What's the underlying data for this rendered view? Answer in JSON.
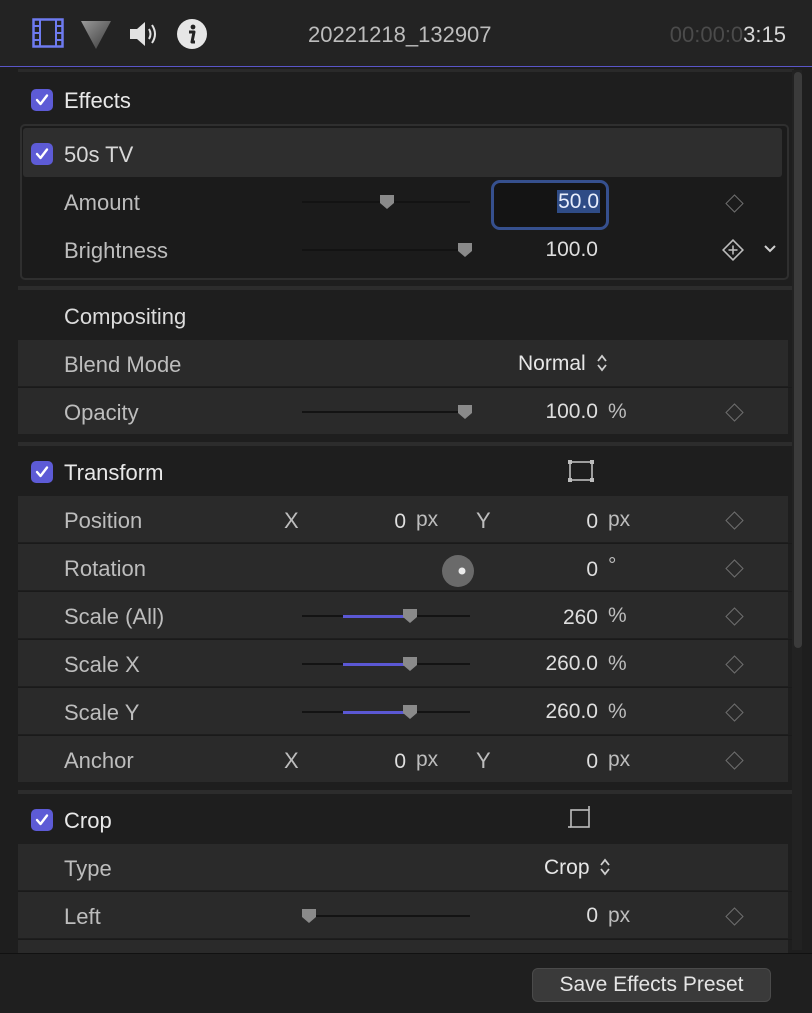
{
  "header": {
    "clip_name": "20221218_132907",
    "timecode_dim": "00:00:0",
    "timecode_bright": "3:15",
    "tabs": [
      "video-tab-icon",
      "color-tab-icon",
      "audio-tab-icon",
      "info-tab-icon"
    ]
  },
  "effects": {
    "title": "Effects",
    "checked": true,
    "tv": {
      "title": "50s TV",
      "checked": true,
      "amount": {
        "label": "Amount",
        "value": "50.0",
        "level": 0.5
      },
      "brightness": {
        "label": "Brightness",
        "value": "100.0",
        "level": 1.0
      }
    }
  },
  "compositing": {
    "title": "Compositing",
    "blend_mode": {
      "label": "Blend Mode",
      "value": "Normal"
    },
    "opacity": {
      "label": "Opacity",
      "value": "100.0",
      "unit": "%",
      "level": 1.0
    }
  },
  "transform": {
    "title": "Transform",
    "checked": true,
    "position": {
      "label": "Position",
      "x_label": "X",
      "x": "0",
      "x_unit": "px",
      "y_label": "Y",
      "y": "0",
      "y_unit": "px"
    },
    "rotation": {
      "label": "Rotation",
      "value": "0",
      "unit": "°"
    },
    "scale_all": {
      "label": "Scale (All)",
      "value": "260",
      "unit": "%"
    },
    "scale_x": {
      "label": "Scale X",
      "value": "260.0",
      "unit": "%"
    },
    "scale_y": {
      "label": "Scale Y",
      "value": "260.0",
      "unit": "%"
    },
    "anchor": {
      "label": "Anchor",
      "x_label": "X",
      "x": "0",
      "x_unit": "px",
      "y_label": "Y",
      "y": "0",
      "y_unit": "px"
    }
  },
  "crop": {
    "title": "Crop",
    "checked": true,
    "type": {
      "label": "Type",
      "value": "Crop"
    },
    "left": {
      "label": "Left",
      "value": "0",
      "unit": "px",
      "level": 0.0
    }
  },
  "footer": {
    "save_button": "Save Effects Preset"
  },
  "colors": {
    "accent": "#5d5bd6",
    "background": "#1e1e1e",
    "row": "#2a2a2a"
  }
}
